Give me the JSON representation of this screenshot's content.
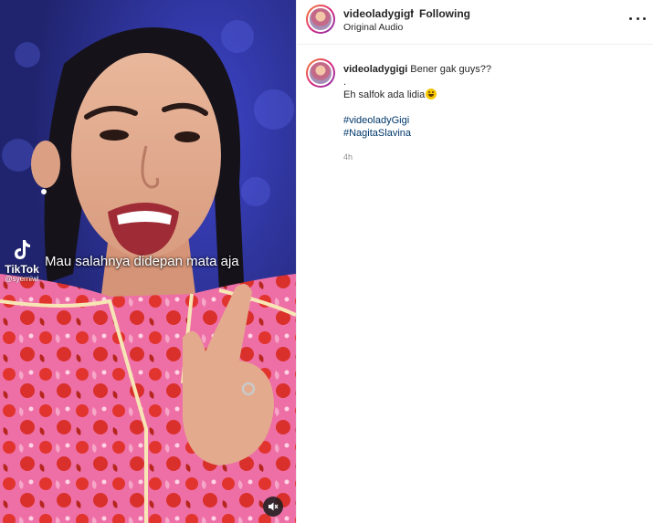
{
  "video": {
    "overlay_caption": "Mau salahnya didepan mata aja",
    "watermark": {
      "brand": "TikTok",
      "handle": "@syerniwi"
    },
    "mute_icon": "speaker-muted-icon"
  },
  "header": {
    "username": "videoladygigi",
    "separator": "•",
    "follow_status": "Following",
    "audio_label": "Original Audio",
    "more_icon": "more-horizontal-icon"
  },
  "comment": {
    "username": "videoladygigi",
    "text": "Bener gak guys??",
    "dot_line": ".",
    "line2": "Eh salfok ada lidia",
    "line2_emoji": "grinning-face-emoji",
    "hashtags": [
      "#videoladyGigi",
      "#NagitaSlavina"
    ],
    "time": "4h"
  },
  "colors": {
    "link": "#00376b",
    "muted_text": "#8e8e8e",
    "divider": "#efefef"
  }
}
